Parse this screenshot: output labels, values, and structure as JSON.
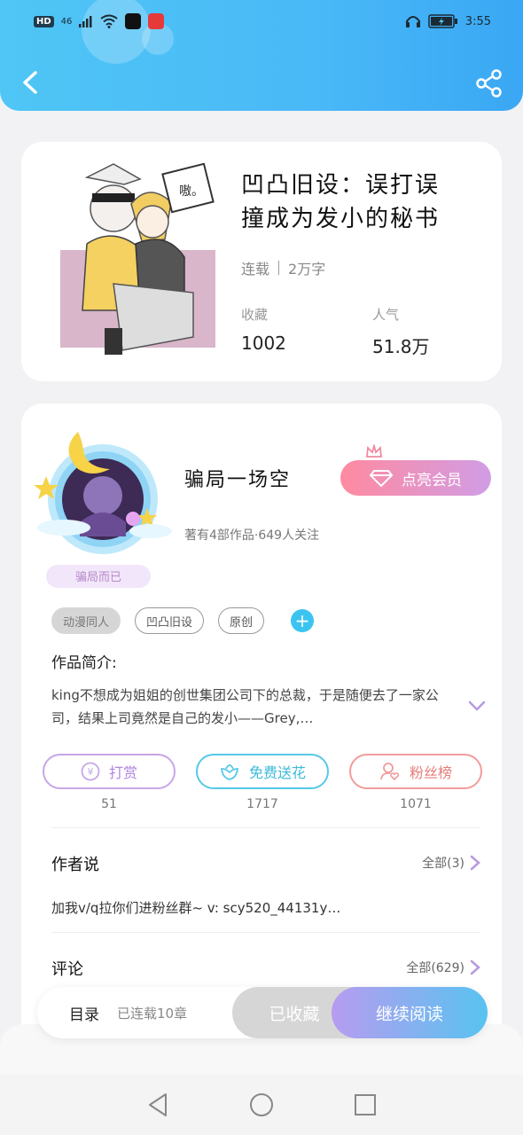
{
  "status_bar": {
    "hd": "HD",
    "network": "46",
    "time": "3:55"
  },
  "book": {
    "title": "凹凸旧设：误打误撞成为发小的秘书",
    "status": "连载",
    "word_count": "2万字",
    "collect_label": "收藏",
    "collect_value": "1002",
    "popularity_label": "人气",
    "popularity_value": "51.8万",
    "cover_bubble_text": "嗷。"
  },
  "author": {
    "name": "骗局一场空",
    "subtitle": "著有4部作品·649人关注",
    "avatar_badge": "骗局而已",
    "vip_button": "点亮会员",
    "tags": [
      "动漫同人",
      "凹凸旧设",
      "原创"
    ],
    "intro_label": "作品简介:",
    "intro_text": "king不想成为姐姐的创世集团公司下的总裁，于是随便去了一家公司，结果上司竟然是自己的发小——Grey,…"
  },
  "actions": [
    {
      "label": "打赏",
      "count": "51",
      "icon": "yen-icon"
    },
    {
      "label": "免费送花",
      "count": "1717",
      "icon": "flower-icon"
    },
    {
      "label": "粉丝榜",
      "count": "1071",
      "icon": "fans-icon"
    }
  ],
  "author_says": {
    "title": "作者说",
    "more": "全部(3)",
    "text": "加我v/q拉你们进粉丝群~ v: scy520_44131y…"
  },
  "comments": {
    "title": "评论",
    "more": "全部(629)"
  },
  "bottom_bar": {
    "catalog": "目录",
    "serial": "已连载10章",
    "collected": "已收藏",
    "continue": "继续阅读"
  },
  "colors": {
    "header": "#4ab9f7",
    "accent_blue": "#3cc4f0",
    "vip_gradient_start": "#ff8aa0",
    "vip_gradient_end": "#d19de5"
  }
}
